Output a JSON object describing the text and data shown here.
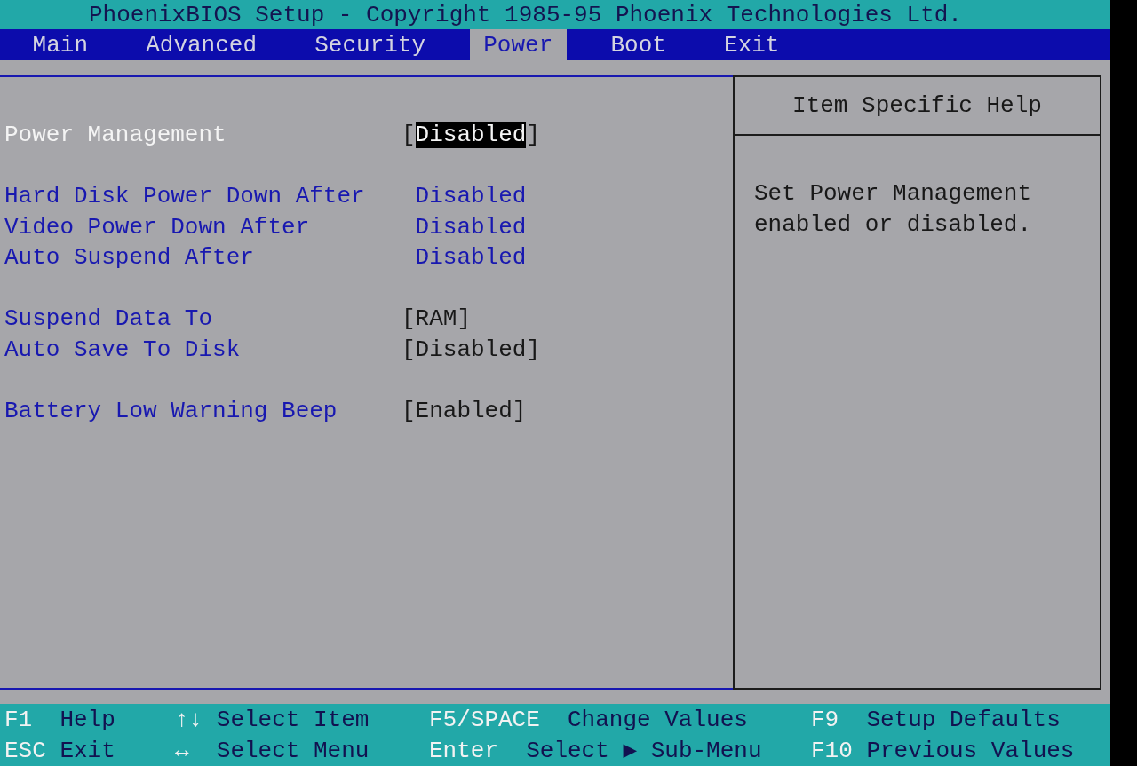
{
  "title": "PhoenixBIOS Setup - Copyright 1985-95 Phoenix Technologies Ltd.",
  "tabs": [
    {
      "label": "Main",
      "selected": false
    },
    {
      "label": "Advanced",
      "selected": false
    },
    {
      "label": "Security",
      "selected": false
    },
    {
      "label": "Power",
      "selected": true
    },
    {
      "label": "Boot",
      "selected": false
    },
    {
      "label": "Exit",
      "selected": false
    }
  ],
  "sections": [
    {
      "items": [
        {
          "label": "Power Management",
          "bracket_open": "[",
          "value": "Disabled",
          "bracket_close": "]",
          "selected": true,
          "disabled": false
        }
      ]
    },
    {
      "items": [
        {
          "label": "Hard Disk Power Down After",
          "value": "Disabled",
          "selected": false,
          "disabled": true
        },
        {
          "label": "Video Power Down After",
          "value": "Disabled",
          "selected": false,
          "disabled": true
        },
        {
          "label": "Auto Suspend After",
          "value": "Disabled",
          "selected": false,
          "disabled": true
        }
      ]
    },
    {
      "items": [
        {
          "label": "Suspend Data To",
          "bracket_open": "[",
          "value": "RAM",
          "bracket_close": "]",
          "selected": false,
          "disabled": false
        },
        {
          "label": "Auto Save To Disk",
          "bracket_open": "[",
          "value": "Disabled",
          "bracket_close": "]",
          "selected": false,
          "disabled": false
        }
      ]
    },
    {
      "items": [
        {
          "label": "Battery Low Warning Beep",
          "bracket_open": "[",
          "value": "Enabled",
          "bracket_close": "]",
          "selected": false,
          "disabled": false
        }
      ]
    }
  ],
  "help_panel": {
    "title": "Item Specific Help",
    "text": "Set Power Management enabled or disabled."
  },
  "footer": {
    "rows": [
      [
        {
          "key": "F1",
          "action": "Help"
        },
        {
          "key": "↑↓",
          "action": "Select Item"
        },
        {
          "key": "F5/SPACE",
          "action": "Change Values"
        },
        {
          "key": "F9",
          "action": "Setup Defaults"
        }
      ],
      [
        {
          "key": "ESC",
          "action": "Exit"
        },
        {
          "key": "↔",
          "action": "Select Menu"
        },
        {
          "key": "Enter",
          "action": "Select ▶ Sub-Menu"
        },
        {
          "key": "F10",
          "action": "Previous Values"
        }
      ]
    ]
  }
}
